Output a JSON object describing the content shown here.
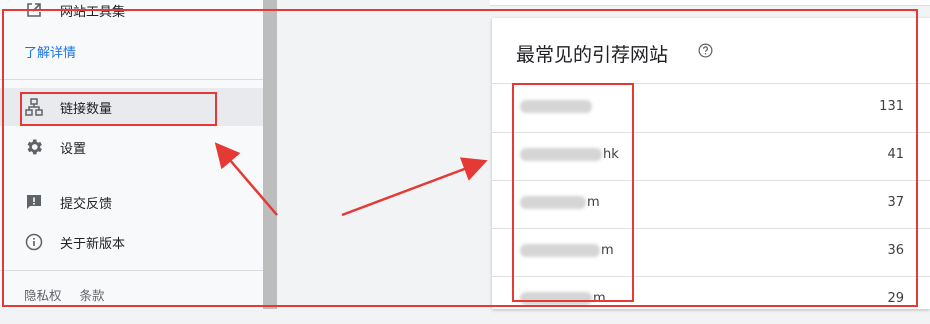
{
  "sidebar": {
    "webmaster_tools_label": "网站工具集",
    "learn_more_link": "了解详情",
    "links_item_label": "链接数量",
    "settings_label": "设置",
    "feedback_label": "提交反馈",
    "about_label": "关于新版本",
    "footer_privacy": "隐私权",
    "footer_terms": "条款",
    "icons": [
      "open-in-new-icon",
      "sitemap-icon",
      "gear-icon",
      "feedback-icon",
      "info-icon"
    ]
  },
  "card": {
    "title": "最常见的引荐网站",
    "rows": [
      {
        "site_tail": "",
        "count": "131"
      },
      {
        "site_tail": "hk",
        "count": "41"
      },
      {
        "site_tail": "m",
        "count": "37"
      },
      {
        "site_tail": "m",
        "count": "36"
      },
      {
        "site_tail": "m",
        "count": "29"
      }
    ]
  },
  "colors": {
    "annotation": "#e53935",
    "link": "#1a73e8",
    "selected_bg": "#e8eaed"
  }
}
